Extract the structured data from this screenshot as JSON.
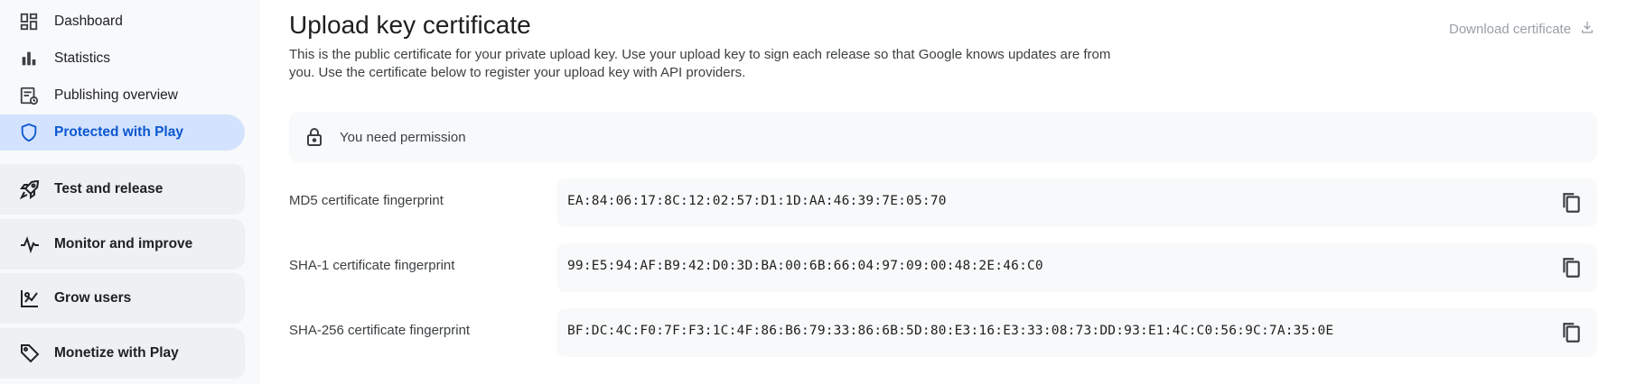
{
  "sidebar": {
    "items": [
      {
        "label": "Dashboard",
        "icon": "dashboard-icon"
      },
      {
        "label": "Statistics",
        "icon": "bar-chart-icon"
      },
      {
        "label": "Publishing overview",
        "icon": "publishing-overview-icon"
      },
      {
        "label": "Protected with Play",
        "icon": "shield-icon",
        "active": true
      }
    ],
    "groups": [
      {
        "label": "Test and release",
        "icon": "rocket-icon"
      },
      {
        "label": "Monitor and improve",
        "icon": "pulse-icon"
      },
      {
        "label": "Grow users",
        "icon": "grow-users-icon"
      },
      {
        "label": "Monetize with Play",
        "icon": "tag-icon"
      }
    ]
  },
  "main": {
    "title": "Upload key certificate",
    "description_line1": "This is the public certificate for your private upload key. Use your upload key to sign each release so that Google knows updates are from",
    "description_line2": "you. Use the certificate below to register your upload key with API providers.",
    "download_label": "Download certificate",
    "permission_text": "You need permission",
    "fingerprints": [
      {
        "label": "MD5 certificate fingerprint",
        "value": "EA:84:06:17:8C:12:02:57:D1:1D:AA:46:39:7E:05:70"
      },
      {
        "label": "SHA-1 certificate fingerprint",
        "value": "99:E5:94:AF:B9:42:D0:3D:BA:00:6B:66:04:97:09:00:48:2E:46:C0"
      },
      {
        "label": "SHA-256 certificate fingerprint",
        "value": "BF:DC:4C:F0:7F:F3:1C:4F:86:B6:79:33:86:6B:5D:80:E3:16:E3:33:08:73:DD:93:E1:4C:C0:56:9C:7A:35:0E"
      }
    ]
  },
  "colors": {
    "accent": "#0b57d0",
    "active_bg": "#d3e3fd",
    "sidebar_bg": "#f8f9fb",
    "box_bg": "#f8f9fa"
  }
}
